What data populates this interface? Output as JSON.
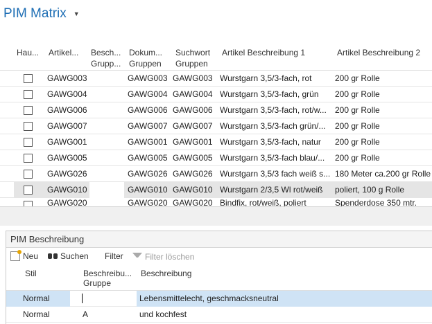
{
  "page": {
    "title": "PIM Matrix"
  },
  "grid": {
    "headers": {
      "haupt": "Hau...",
      "artikel": "Artikel...",
      "besch_1": "Besch...",
      "besch_2": "Grupp...",
      "dokum_1": "Dokum...",
      "dokum_2": "Gruppen",
      "such_1": "Suchwort",
      "such_2": "Gruppen",
      "desc1": "Artikel Beschreibung 1",
      "desc2": "Artikel Beschreibung 2"
    },
    "rows": [
      {
        "artikel": "GAWG003",
        "dokum": "GAWG003",
        "such": "GAWG003",
        "desc1": "Wurstgarn 3,5/3-fach, rot",
        "desc2": "200 gr Rolle"
      },
      {
        "artikel": "GAWG004",
        "dokum": "GAWG004",
        "such": "GAWG004",
        "desc1": "Wurstgarn 3,5/3-fach, grün",
        "desc2": "200 gr Rolle"
      },
      {
        "artikel": "GAWG006",
        "dokum": "GAWG006",
        "such": "GAWG006",
        "desc1": "Wurstgarn 3,5/3-fach, rot/w...",
        "desc2": "200 gr Rolle"
      },
      {
        "artikel": "GAWG007",
        "dokum": "GAWG007",
        "such": "GAWG007",
        "desc1": "Wurstgarn 3,5/3-fach grün/...",
        "desc2": "200 gr Rolle"
      },
      {
        "artikel": "GAWG001",
        "dokum": "GAWG001",
        "such": "GAWG001",
        "desc1": "Wurstgarn 3,5/3-fach, natur",
        "desc2": "200 gr Rolle"
      },
      {
        "artikel": "GAWG005",
        "dokum": "GAWG005",
        "such": "GAWG005",
        "desc1": "Wurstgarn 3,5/3-fach blau/...",
        "desc2": "200 gr Rolle"
      },
      {
        "artikel": "GAWG026",
        "dokum": "GAWG026",
        "such": "GAWG026",
        "desc1": "Wurstgarn 3,5/3 fach weiß s...",
        "desc2": "180 Meter ca.200 gr Rolle"
      },
      {
        "artikel": "GAWG010",
        "dokum": "GAWG010",
        "such": "GAWG010",
        "desc1": "Wurstgarn 2/3,5 Wl rot/weiß",
        "desc2": "poliert, 100 g Rolle"
      },
      {
        "artikel": "GAWG020",
        "dokum": "GAWG020",
        "such": "GAWG020",
        "desc1": "Bindfix, rot/weiß, poliert",
        "desc2": "Spenderdose 350 mtr."
      }
    ]
  },
  "panel": {
    "title": "PIM Beschreibung",
    "toolbar": {
      "new": "Neu",
      "find": "Suchen",
      "filter": "Filter",
      "clear_filter": "Filter löschen"
    },
    "headers": {
      "stil": "Stil",
      "gruppe_1": "Beschreibu...",
      "gruppe_2": "Gruppe",
      "beschreibung": "Beschreibung"
    },
    "rows": [
      {
        "stil": "Normal",
        "gruppe": "",
        "beschreibung": "Lebensmittelecht, geschmacksneutral"
      },
      {
        "stil": "Normal",
        "gruppe": "A",
        "beschreibung": "und kochfest"
      }
    ]
  }
}
